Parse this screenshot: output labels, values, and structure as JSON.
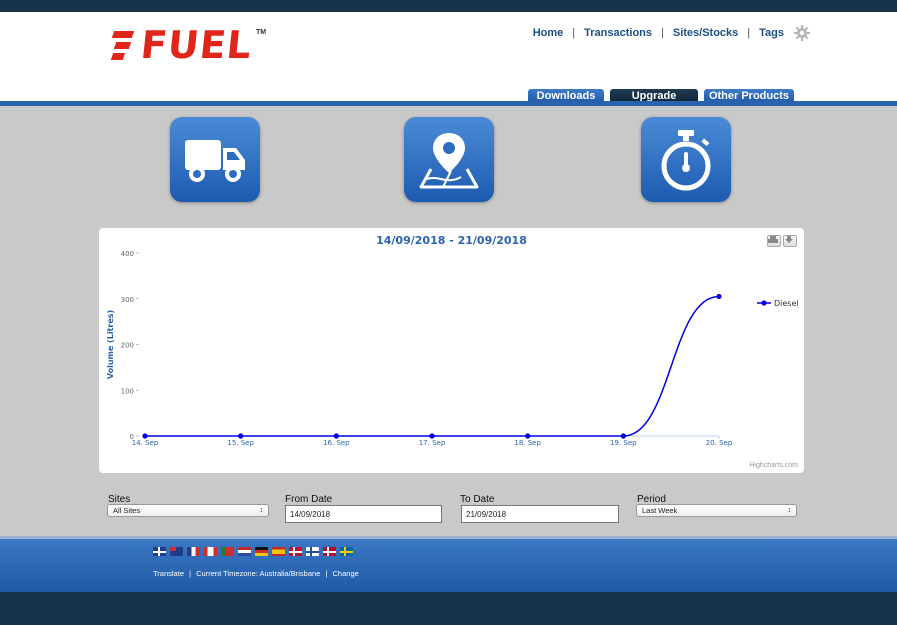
{
  "brand": {
    "logo_text": "FUEL",
    "trademark": "TM"
  },
  "nav": {
    "home": "Home",
    "transactions": "Transactions",
    "sites_stocks": "Sites/Stocks",
    "tags": "Tags",
    "separator": "|"
  },
  "tabs": {
    "downloads": "Downloads",
    "upgrade": "Upgrade",
    "other_products": "Other Products"
  },
  "tiles": [
    "truck-icon",
    "map-pin-icon",
    "stopwatch-icon"
  ],
  "chart_data": {
    "type": "line",
    "title": "14/09/2018 - 21/09/2018",
    "ylabel": "Volume (Litres)",
    "xlabel": "",
    "categories": [
      "14. Sep",
      "15. Sep",
      "16. Sep",
      "17. Sep",
      "18. Sep",
      "19. Sep",
      "20. Sep"
    ],
    "y_ticks": [
      "0",
      "100",
      "200",
      "300",
      "400"
    ],
    "ylim": [
      0,
      400
    ],
    "series": [
      {
        "name": "Diesel",
        "values": [
          0,
          0,
          0,
          0,
          0,
          0,
          305
        ],
        "color": "#0000e0"
      }
    ],
    "legend_position": "right",
    "credit": "Highcharts.com"
  },
  "filters": {
    "sites_label": "Sites",
    "sites_value": "All Sites",
    "from_label": "From Date",
    "from_value": "14/09/2018",
    "to_label": "To Date",
    "to_value": "21/09/2018",
    "period_label": "Period",
    "period_value": "Last Week"
  },
  "footer": {
    "flags": [
      "uk-flag",
      "new-zealand-flag",
      "france-flag",
      "canada-flag",
      "portugal-flag",
      "netherlands-flag",
      "germany-flag",
      "spain-flag",
      "denmark-flag",
      "finland-flag",
      "norway-flag",
      "sweden-flag"
    ],
    "translate": "Translate",
    "timezone_label": "Current Timezone: Australia/Brisbane",
    "change": "Change"
  },
  "colors": {
    "accent": "#2a63ad",
    "brand_red": "#e0251b",
    "dark": "#16334a",
    "series": "#0000e0"
  }
}
